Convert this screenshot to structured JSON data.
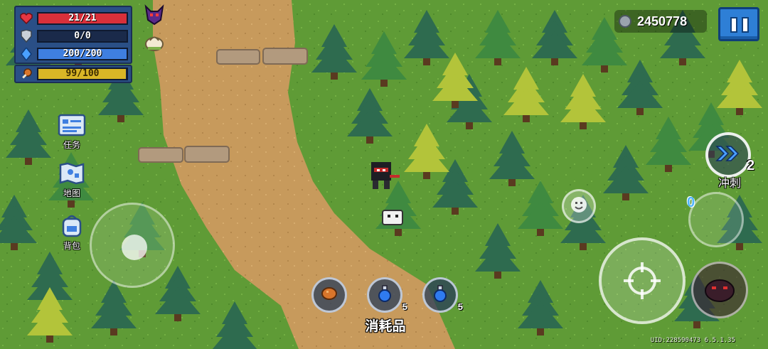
{
  "hud": {
    "health": {
      "text": "21/21",
      "fraction": 1.0,
      "color": "#d8303a"
    },
    "armor": {
      "text": "0/0",
      "fraction": 0.0,
      "color": "#9aa3ad"
    },
    "energy": {
      "text": "200/200",
      "fraction": 1.0,
      "color": "#3f7fe0"
    },
    "hunger": {
      "text": "99/100",
      "fraction": 0.99,
      "color": "#d9b626"
    }
  },
  "buffs": [
    {
      "name": "demon-horn-buff-icon"
    },
    {
      "name": "steamed-bun-buff-icon"
    }
  ],
  "side_menu": [
    {
      "label": "任务",
      "icon": "quest-icon"
    },
    {
      "label": "地图",
      "icon": "map-icon"
    },
    {
      "label": "背包",
      "icon": "backpack-icon"
    }
  ],
  "coins": {
    "value": "2450778",
    "icon": "gem-coin-icon"
  },
  "consumables": {
    "label": "消耗品",
    "items": [
      {
        "icon": "roast-meat-icon",
        "count": ""
      },
      {
        "icon": "blue-potion-icon",
        "count": "5"
      },
      {
        "icon": "blue-potion-icon",
        "count": "5"
      }
    ]
  },
  "skill": {
    "label": "冲刺",
    "count": "2",
    "icon": "dash-arrows-icon"
  },
  "weapon": {
    "count": "0"
  },
  "uid": "UID:228590473 6.5.1.35",
  "colors": {
    "path": "#c79a5c",
    "grass": "#5f9b36",
    "hud_panel": "#2a4f86",
    "pause_button": "#2e7fd6"
  }
}
